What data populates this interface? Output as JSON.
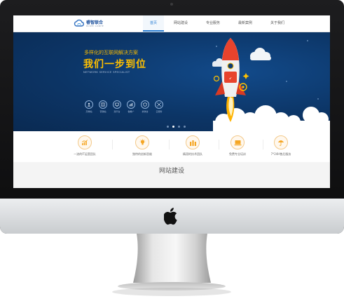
{
  "site": {
    "logo": {
      "name": "睿智联合",
      "tagline": "RUIZHI LIANHE"
    },
    "nav": [
      {
        "label": "首页",
        "active": true
      },
      {
        "label": "网站建设",
        "active": false
      },
      {
        "label": "专业服务",
        "active": false
      },
      {
        "label": "最新案例",
        "active": false
      },
      {
        "label": "关于我们",
        "active": false
      }
    ]
  },
  "banner": {
    "headline_small": "多样化的互联网解决方案",
    "headline_big": "我们一步到位",
    "subtitle": "NETWORK SERVICE SPECIALIST",
    "icons": [
      {
        "icon": "user-icon",
        "label": "高端站"
      },
      {
        "icon": "book-icon",
        "label": "营销站"
      },
      {
        "icon": "monitor-icon",
        "label": "建平台"
      },
      {
        "icon": "chart-icon",
        "label": "做推广"
      },
      {
        "icon": "shield-icon",
        "label": "抗攻击"
      },
      {
        "icon": "network-icon",
        "label": "云服务"
      }
    ],
    "slides": {
      "count": 4,
      "active_index": 1
    },
    "colors": {
      "accent": "#ffc000",
      "background": "#0c3566"
    }
  },
  "features": [
    {
      "icon": "growth-chart-icon",
      "label": "一流的IT运营团队"
    },
    {
      "icon": "lightbulb-icon",
      "label": "独特的创新思维"
    },
    {
      "icon": "team-icon",
      "label": "精湛的技术团队"
    },
    {
      "icon": "laptop-icon",
      "label": "免费专业培训"
    },
    {
      "icon": "umbrella-icon",
      "label": "7*24H售后服务"
    }
  ],
  "section": {
    "title": "网站建设"
  },
  "theme": {
    "feature_accent": "#f5a623",
    "nav_active": "#2a7fd4"
  }
}
